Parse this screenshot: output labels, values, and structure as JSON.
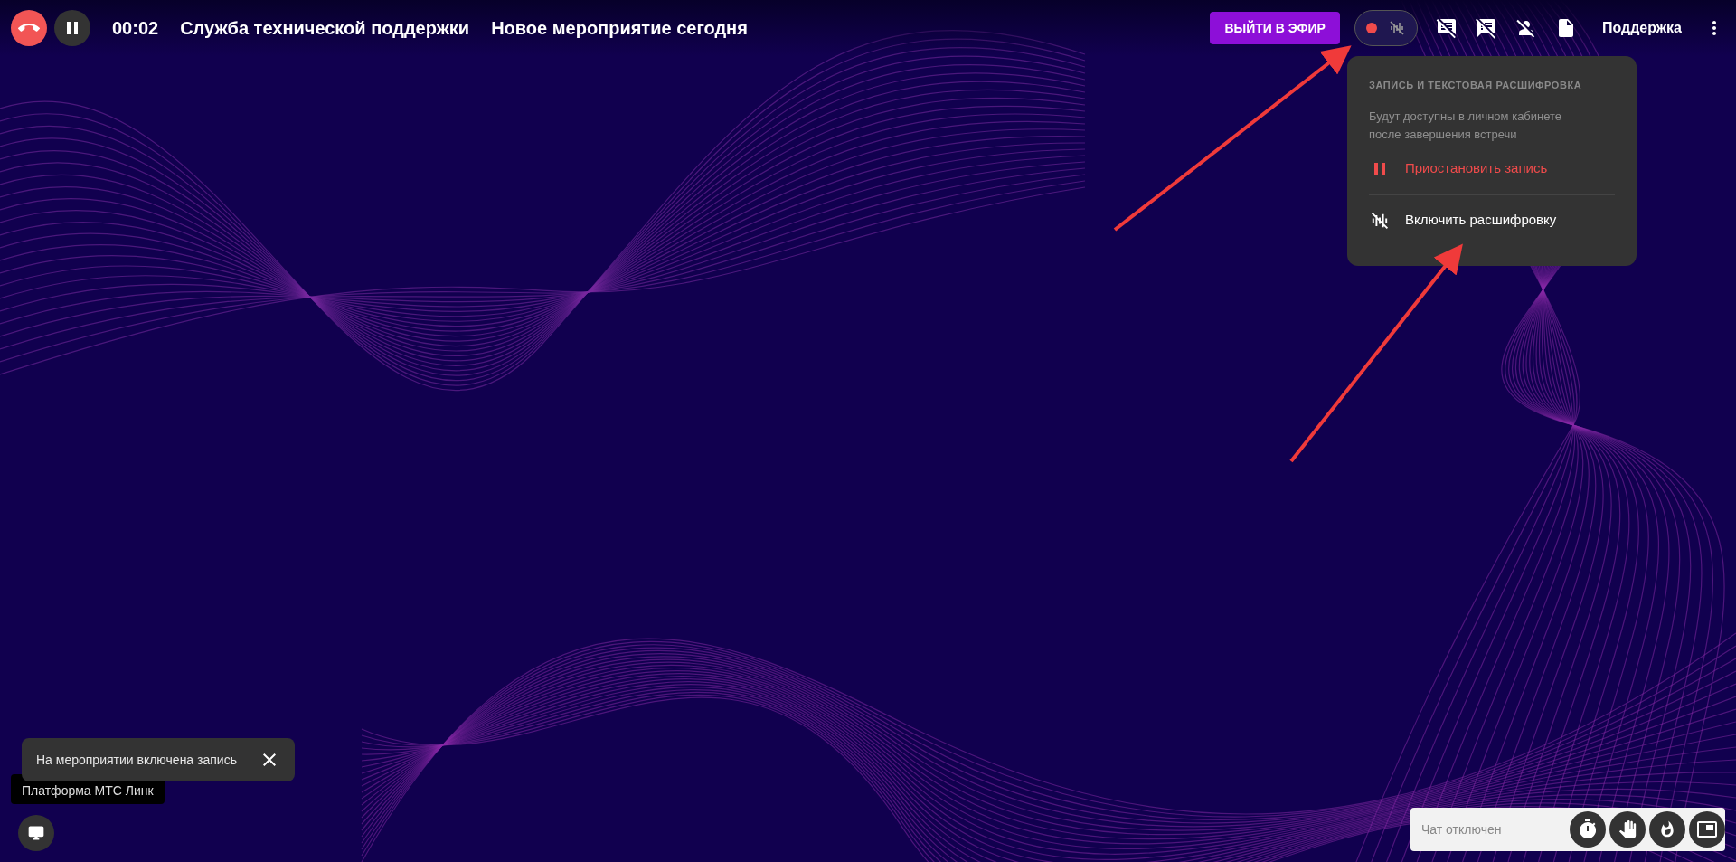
{
  "top_bar": {
    "timer": "00:02",
    "title": "Служба технической поддержки",
    "event_title": "Новое мероприятие сегодня",
    "go_live_button": "ВЫЙТИ В ЭФИР",
    "record_toggle": {
      "recording": true
    },
    "support_link": "Поддержка"
  },
  "record_menu": {
    "heading": "ЗАПИСЬ И ТЕКСТОВАЯ РАСШИФРОВКА",
    "description": "Будут доступны в личном кабинете после завершения встречи",
    "items": [
      {
        "kind": "pause",
        "label": "Приостановить запись"
      },
      {
        "kind": "transcribe",
        "label": "Включить расшифровку"
      }
    ]
  },
  "toast": {
    "text": "На мероприятии включена запись"
  },
  "platform_label": "Платформа МТС Линк",
  "chat": {
    "placeholder": "Чат отключен"
  }
}
